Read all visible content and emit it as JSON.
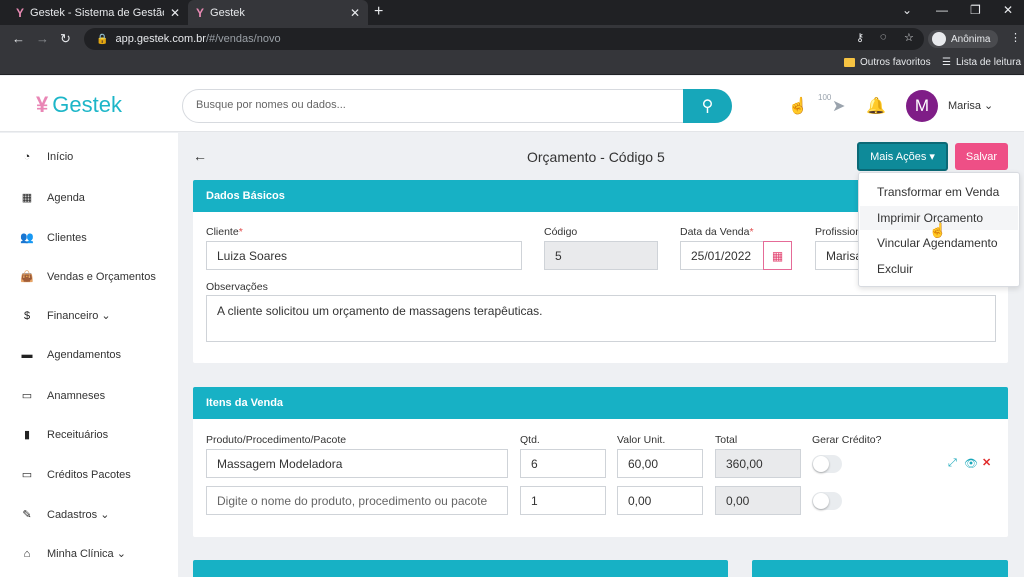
{
  "browser": {
    "tabs": [
      {
        "title": "Gestek - Sistema de Gestão para",
        "logo": "Y"
      },
      {
        "title": "Gestek",
        "logo": "Y"
      }
    ],
    "url_host": "app.gestek.com.br",
    "url_path": "/#/vendas/novo",
    "profile": "Anônima",
    "bookmarks": {
      "other": "Outros favoritos",
      "reading": "Lista de leitura"
    }
  },
  "header": {
    "brand": "Gestek",
    "search_placeholder": "Busque por nomes ou dados...",
    "user": "Marisa ⌄",
    "avatar_letter": "M",
    "badge": "100"
  },
  "sidebar": {
    "items": [
      {
        "label": "Início",
        "icon": "dashboard-icon"
      },
      {
        "label": "Agenda",
        "icon": "calendar-icon"
      },
      {
        "label": "Clientes",
        "icon": "users-icon"
      },
      {
        "label": "Vendas e Orçamentos",
        "icon": "bag-icon"
      },
      {
        "label": "Financeiro ⌄",
        "icon": "dollar-icon"
      },
      {
        "label": "Agendamentos",
        "icon": "calendar-check-icon"
      },
      {
        "label": "Anamneses",
        "icon": "id-card-icon"
      },
      {
        "label": "Receituários",
        "icon": "file-icon"
      },
      {
        "label": "Créditos Pacotes",
        "icon": "credit-card-icon"
      },
      {
        "label": "Cadastros ⌄",
        "icon": "edit-icon"
      },
      {
        "label": "Minha Clínica ⌄",
        "icon": "home-icon"
      }
    ]
  },
  "page": {
    "title": "Orçamento - Código 5",
    "more_actions": "Mais Ações ▾",
    "save": "Salvar",
    "menu": [
      "Transformar em Venda",
      "Imprimir Orçamento",
      "Vincular Agendamento",
      "Excluir"
    ]
  },
  "basic": {
    "header": "Dados Básicos",
    "client_label": "Cliente",
    "client_value": "Luiza Soares",
    "code_label": "Código",
    "code_value": "5",
    "date_label": "Data da Venda",
    "date_value": "25/01/2022",
    "prof_label": "Profissional",
    "prof_value": "Marisa",
    "obs_label": "Observações",
    "obs_value": "A cliente solicitou um orçamento de massagens terapêuticas.",
    "required_mark": "*"
  },
  "items": {
    "header": "Itens da Venda",
    "columns": [
      "Produto/Procedimento/Pacote",
      "Qtd.",
      "Valor Unit.",
      "Total",
      "Gerar Crédito?"
    ],
    "rows": [
      {
        "product": "Massagem Modeladora",
        "qty": "6",
        "unit": "60,00",
        "total": "360,00"
      },
      {
        "product_placeholder": "Digite o nome do produto, procedimento ou pacote",
        "qty": "1",
        "unit": "0,00",
        "total": "0,00"
      }
    ]
  },
  "colors": {
    "accent": "#17b1c5",
    "save": "#ee4f86",
    "more": "#0e8a99"
  }
}
